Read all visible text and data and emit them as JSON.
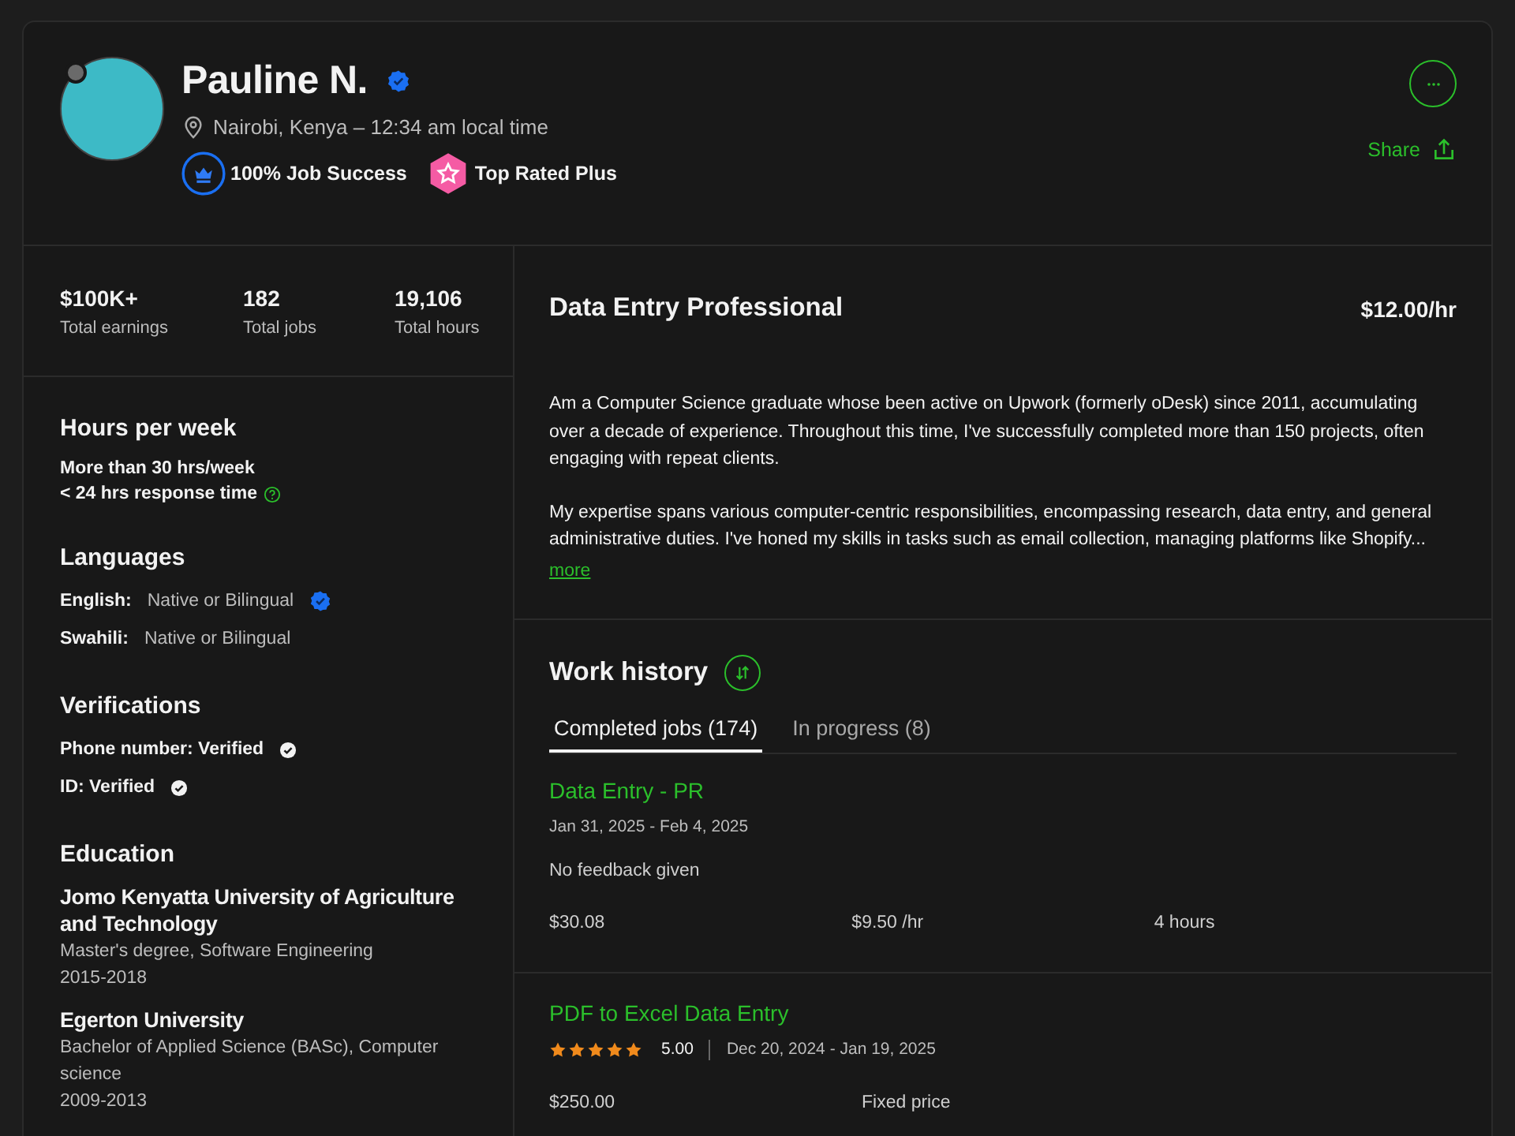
{
  "profile": {
    "name": "Pauline N.",
    "location": "Nairobi, Kenya – 12:34 am local time",
    "badges": [
      {
        "kind": "success",
        "label": "100% Job Success"
      },
      {
        "kind": "top_rated",
        "label": "Top Rated Plus"
      }
    ],
    "share": "Share"
  },
  "stats": [
    {
      "value": "$100K+",
      "label": "Total earnings"
    },
    {
      "value": "182",
      "label": "Total jobs"
    },
    {
      "value": "19,106",
      "label": "Total hours"
    }
  ],
  "hours": {
    "title": "Hours per week",
    "lines": [
      "More than 30 hrs/week",
      "< 24 hrs response time"
    ]
  },
  "languages": {
    "title": "Languages",
    "items": [
      {
        "name": "English:",
        "level": "Native or Bilingual",
        "verified": true
      },
      {
        "name": "Swahili:",
        "level": "Native or Bilingual",
        "verified": false
      }
    ]
  },
  "verifications": {
    "title": "Verifications",
    "items": [
      "Phone number: Verified",
      "ID: Verified"
    ]
  },
  "education": {
    "title": "Education",
    "items": [
      {
        "school": "Jomo Kenyatta University of Agriculture and Technology",
        "degree": "Master's degree, Software Engineering",
        "years": "2015-2018"
      },
      {
        "school": "Egerton University",
        "degree": "Bachelor of Applied Science (BASc), Computer science",
        "years": "2009-2013"
      }
    ]
  },
  "headline": {
    "title": "Data Entry Professional",
    "rate": "$12.00/hr"
  },
  "overview": {
    "paragraphs": [
      "Am a Computer Science graduate whose been active on Upwork (formerly oDesk) since 2011, accumulating over a decade of experience. Throughout this time, I've successfully completed more than 150 projects, often engaging with repeat clients.",
      "My expertise spans various computer-centric responsibilities, encompassing research, data entry, and general administrative duties. I've honed my skills in tasks such as email collection, managing platforms like Shopify..."
    ],
    "more": "more"
  },
  "work_history": {
    "title": "Work history",
    "tabs": [
      {
        "label": "Completed jobs (174)",
        "selected": true
      },
      {
        "label": "In progress (8)",
        "selected": false
      }
    ],
    "jobs": [
      {
        "kind": "no_feedback",
        "title": "Data Entry - PR",
        "dates": "Jan 31, 2025 - Feb 4, 2025",
        "feedback": "No feedback given",
        "stats": [
          "$30.08",
          "$9.50 /hr",
          "4 hours"
        ]
      },
      {
        "kind": "rated",
        "title": "PDF to Excel Data Entry",
        "stars": 5,
        "rating": "5.00",
        "dates": "Dec 20, 2024 - Jan 19, 2025",
        "stats": [
          "$250.00",
          "Fixed price"
        ]
      }
    ]
  }
}
